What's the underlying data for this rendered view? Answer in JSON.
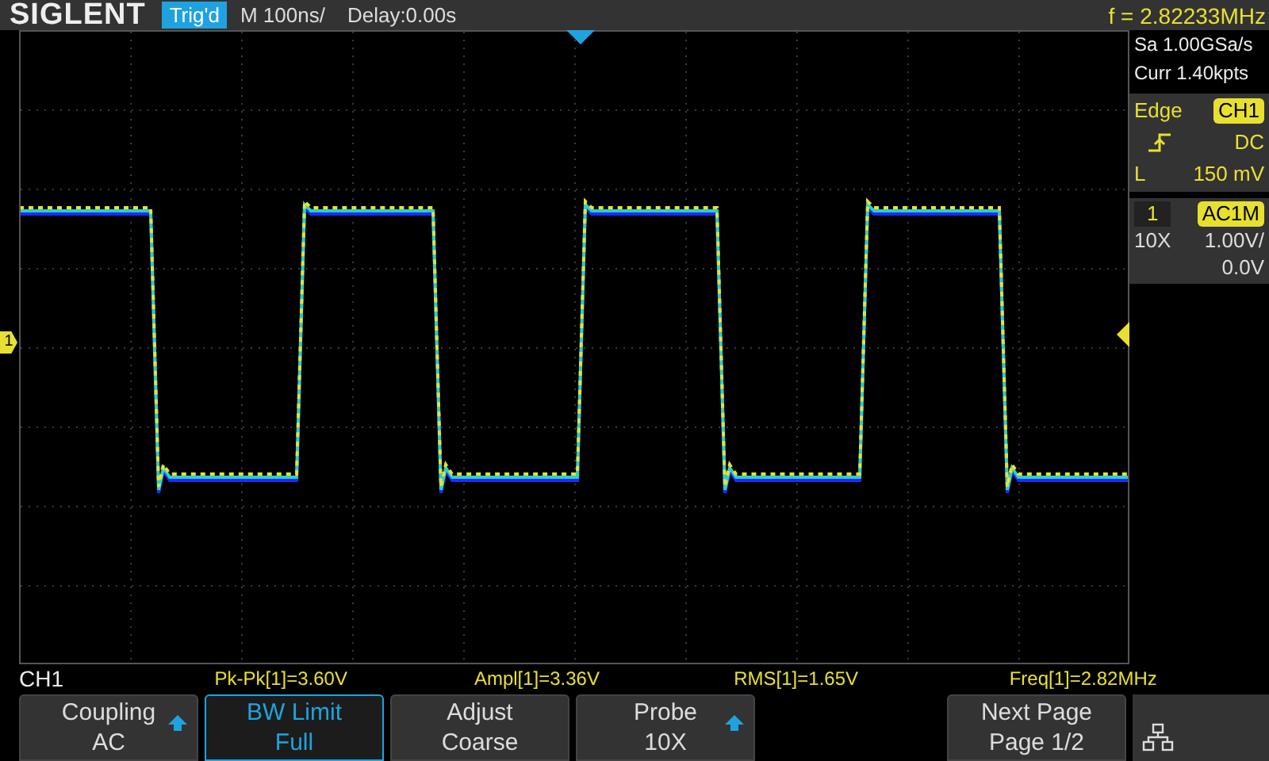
{
  "header": {
    "logo": "SIGLENT",
    "status": "Trig'd",
    "timebase": "M 100ns/",
    "delay": "Delay:0.00s",
    "frequency": "f = 2.82233MHz"
  },
  "acquisition": {
    "sample_rate": "Sa 1.00GSa/s",
    "memory": "Curr 1.40kpts"
  },
  "trigger": {
    "type": "Edge",
    "source": "CH1",
    "coupling": "DC",
    "level_label": "L",
    "level_value": "150 mV"
  },
  "channel": {
    "number": "1",
    "coupling": "AC1M",
    "probe": "10X",
    "scale": "1.00V/",
    "offset": "0.0V"
  },
  "channel_marker": "1",
  "measurements": {
    "channel": "CH1",
    "items": [
      {
        "text": "Pk-Pk[1]=3.60V"
      },
      {
        "text": "Ampl[1]=3.36V"
      },
      {
        "text": "RMS[1]=1.65V"
      },
      {
        "text": "Freq[1]=2.82MHz"
      }
    ]
  },
  "softkeys": [
    {
      "label": "Coupling",
      "value": "AC",
      "selected": false,
      "arrow": true
    },
    {
      "label": "BW Limit",
      "value": "Full",
      "selected": true,
      "arrow": false
    },
    {
      "label": "Adjust",
      "value": "Coarse",
      "selected": false,
      "arrow": false
    },
    {
      "label": "Probe",
      "value": "10X",
      "selected": false,
      "arrow": true
    }
  ],
  "next_page": {
    "label": "Next Page",
    "value": "Page 1/2"
  }
}
